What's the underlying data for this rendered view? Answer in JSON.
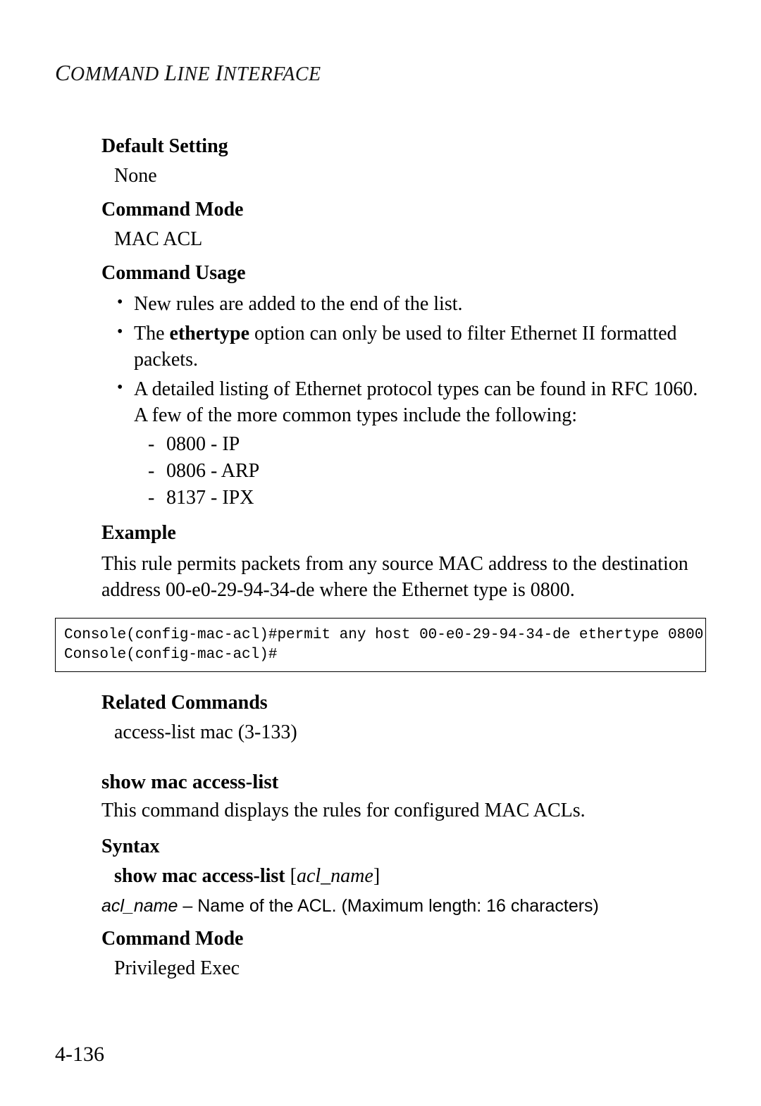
{
  "header": {
    "text": "COMMAND LINE INTERFACE"
  },
  "sections": {
    "default_setting": {
      "title": "Default Setting",
      "value": "None"
    },
    "command_mode_1": {
      "title": "Command Mode",
      "value": "MAC ACL"
    },
    "command_usage": {
      "title": "Command Usage",
      "bullets": {
        "b1": "New rules are added to the end of the list.",
        "b2_pre": "The ",
        "b2_bold": "ethertype",
        "b2_post": " option can only be used to filter Ethernet II formatted packets.",
        "b3": "A detailed listing of Ethernet protocol types can be found in RFC 1060. A few of the more common types include the following:",
        "sub": {
          "s1": "0800 - IP",
          "s2": "0806 - ARP",
          "s3": "8137 - IPX"
        }
      }
    },
    "example": {
      "title": "Example",
      "text": "This rule permits packets from any source MAC address to the destination address 00-e0-29-94-34-de where the Ethernet type is 0800.",
      "code": "Console(config-mac-acl)#permit any host 00-e0-29-94-34-de ethertype 0800\nConsole(config-mac-acl)#"
    },
    "related": {
      "title": "Related Commands",
      "value": "access-list mac (3-133)"
    },
    "show_cmd": {
      "title": "show mac access-list",
      "desc": "This command displays the rules for configured MAC ACLs.",
      "syntax_title": "Syntax",
      "syntax_kw": "show mac access-list",
      "syntax_open": " [",
      "syntax_param": "acl_name",
      "syntax_close": "]",
      "param_name": "acl_name",
      "param_desc": " – Name of the ACL. (Maximum length: 16 characters)",
      "mode_title": "Command Mode",
      "mode_value": "Privileged Exec"
    }
  },
  "page_number": "4-136"
}
